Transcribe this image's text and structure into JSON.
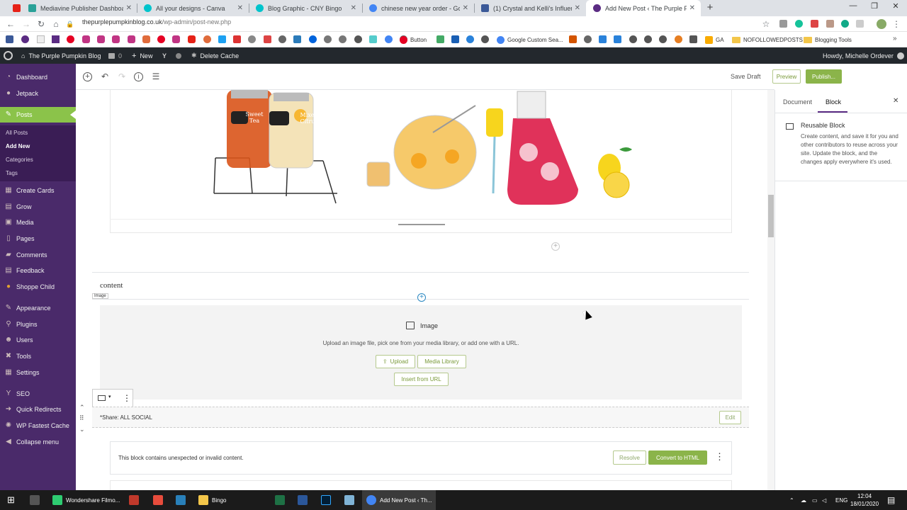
{
  "browser": {
    "tabs": [
      {
        "title": "Mediavine Publisher Dashboard",
        "favicon_color": "#2aa198"
      },
      {
        "title": "All your designs - Canva",
        "favicon_color": "#00c4cc"
      },
      {
        "title": "Blog Graphic - CNY Bingo",
        "favicon_color": "#00c4cc"
      },
      {
        "title": "chinese new year order - Google",
        "favicon_color": "#4285f4"
      },
      {
        "title": "(1) Crystal and Kelli's Influencer S",
        "favicon_color": "#3b5998"
      },
      {
        "title": "Add New Post ‹ The Purple Pump",
        "favicon_color": "#5b2c83"
      }
    ],
    "new_tab_icon": "plus-icon",
    "url_host": "thepurplepumpkinblog.co.uk",
    "url_path": "/wp-admin/post-new.php",
    "bookmarks": [
      {
        "label": "",
        "color": "#3b5998"
      },
      {
        "label": "",
        "color": "#c13584"
      },
      {
        "label": "",
        "color": "#c13584"
      },
      {
        "label": "",
        "color": "#c13584"
      },
      {
        "label": "",
        "color": "#e60023"
      },
      {
        "label": "Button",
        "color": "#e60023"
      },
      {
        "label": "Google Custom Sea...",
        "color": "#4285f4"
      },
      {
        "label": "GA",
        "color": "#f9ab00"
      },
      {
        "label": "NOFOLLOWEDPOSTS",
        "color": "#f3c64a"
      },
      {
        "label": "Blogging Tools",
        "color": "#f3c64a"
      }
    ]
  },
  "adminbar": {
    "site_name": "The Purple Pumpkin Blog",
    "comments_count": "0",
    "new_label": "New",
    "cache_label": "Delete Cache",
    "howdy": "Howdy, Michelle Ordever"
  },
  "sidebar": {
    "items": [
      {
        "label": "Dashboard",
        "icon": "dashboard-icon"
      },
      {
        "label": "Jetpack",
        "icon": "jetpack-icon"
      },
      {
        "label": "Posts",
        "icon": "pin-icon"
      },
      {
        "label": "Create Cards",
        "icon": "cards-icon"
      },
      {
        "label": "Grow",
        "icon": "grow-icon"
      },
      {
        "label": "Media",
        "icon": "media-icon"
      },
      {
        "label": "Pages",
        "icon": "pages-icon"
      },
      {
        "label": "Comments",
        "icon": "comments-icon"
      },
      {
        "label": "Feedback",
        "icon": "feedback-icon"
      },
      {
        "label": "Shoppe Child",
        "icon": "theme-icon"
      },
      {
        "label": "Appearance",
        "icon": "brush-icon"
      },
      {
        "label": "Plugins",
        "icon": "plug-icon"
      },
      {
        "label": "Users",
        "icon": "user-icon"
      },
      {
        "label": "Tools",
        "icon": "wrench-icon"
      },
      {
        "label": "Settings",
        "icon": "settings-icon"
      },
      {
        "label": "SEO",
        "icon": "yoast-icon"
      },
      {
        "label": "Quick Redirects",
        "icon": "redirect-icon"
      },
      {
        "label": "WP Fastest Cache",
        "icon": "cache-icon"
      },
      {
        "label": "Collapse menu",
        "icon": "collapse-icon"
      }
    ],
    "posts_sub": [
      "All Posts",
      "Add New",
      "Categories",
      "Tags"
    ]
  },
  "editor": {
    "save_draft": "Save Draft",
    "preview": "Preview",
    "publish": "Publish...",
    "content_heading": "content",
    "image_badge": "Image",
    "image_block": {
      "title": "Image",
      "description": "Upload an image file, pick one from your media library, or add one with a URL.",
      "upload": "Upload",
      "media_library": "Media Library",
      "insert_url": "Insert from URL"
    },
    "reusable": {
      "label": "*Share: ALL SOCIAL",
      "edit": "Edit"
    },
    "invalid": {
      "message": "This block contains unexpected or invalid content.",
      "resolve": "Resolve",
      "convert": "Convert to HTML"
    },
    "illustration_labels": [
      "Sweet Tea",
      "Mixed Citrus"
    ]
  },
  "panel": {
    "tab_document": "Document",
    "tab_block": "Block",
    "block_title": "Reusable Block",
    "block_desc": "Create content, and save it for you and other contributors to reuse across your site. Update the block, and the changes apply everywhere it's used."
  },
  "taskbar": {
    "items": [
      {
        "label": "Wondershare Filmo...",
        "color": "#2ecc71"
      },
      {
        "label": "",
        "color": "#c0392b"
      },
      {
        "label": "",
        "color": "#e74c3c"
      },
      {
        "label": "",
        "color": "#2980b9"
      },
      {
        "label": "Bingo",
        "color": "#f3c64a"
      },
      {
        "label": "",
        "color": "#1e7145"
      },
      {
        "label": "",
        "color": "#2b579a"
      },
      {
        "label": "",
        "color": "#31a8ff"
      },
      {
        "label": "",
        "color": "#7fb3d5"
      },
      {
        "label": "Add New Post ‹ Th...",
        "color": "#4285f4"
      }
    ],
    "lang": "ENG",
    "time": "12:04",
    "date": "18/01/2020"
  }
}
